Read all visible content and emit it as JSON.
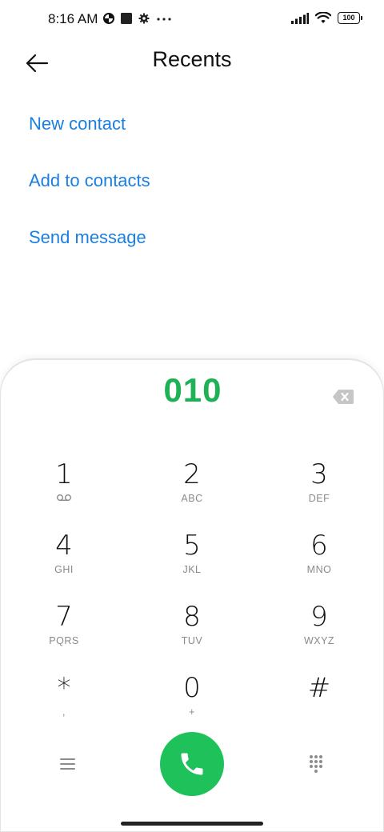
{
  "status_bar": {
    "time": "8:16 AM",
    "battery": "100",
    "icons_left": [
      "data-saver-icon",
      "square-icon",
      "settings-icon",
      "more-dots-icon"
    ],
    "icons_right": [
      "signal-icon",
      "wifi-icon",
      "battery-icon"
    ]
  },
  "header": {
    "title": "Recents",
    "back_icon": "arrow-left-icon"
  },
  "actions": [
    {
      "label": "New contact"
    },
    {
      "label": "Add to contacts"
    },
    {
      "label": "Send message"
    }
  ],
  "dialer": {
    "number": "010",
    "backspace_icon": "backspace-icon"
  },
  "keypad": [
    {
      "digit": "1",
      "letters": "",
      "icon": "voicemail-icon"
    },
    {
      "digit": "2",
      "letters": "ABC"
    },
    {
      "digit": "3",
      "letters": "DEF"
    },
    {
      "digit": "4",
      "letters": "GHI"
    },
    {
      "digit": "5",
      "letters": "JKL"
    },
    {
      "digit": "6",
      "letters": "MNO"
    },
    {
      "digit": "7",
      "letters": "PQRS"
    },
    {
      "digit": "8",
      "letters": "TUV"
    },
    {
      "digit": "9",
      "letters": "WXYZ"
    },
    {
      "digit": "*",
      "letters": ","
    },
    {
      "digit": "0",
      "letters": "+"
    },
    {
      "digit": "#",
      "letters": ""
    }
  ],
  "bottom_bar": {
    "menu_icon": "menu-icon",
    "call_icon": "phone-icon",
    "keypad_icon": "dialpad-icon"
  },
  "colors": {
    "accent_blue": "#1a7fe0",
    "number_green": "#1fb155",
    "call_green": "#1fc15a"
  }
}
